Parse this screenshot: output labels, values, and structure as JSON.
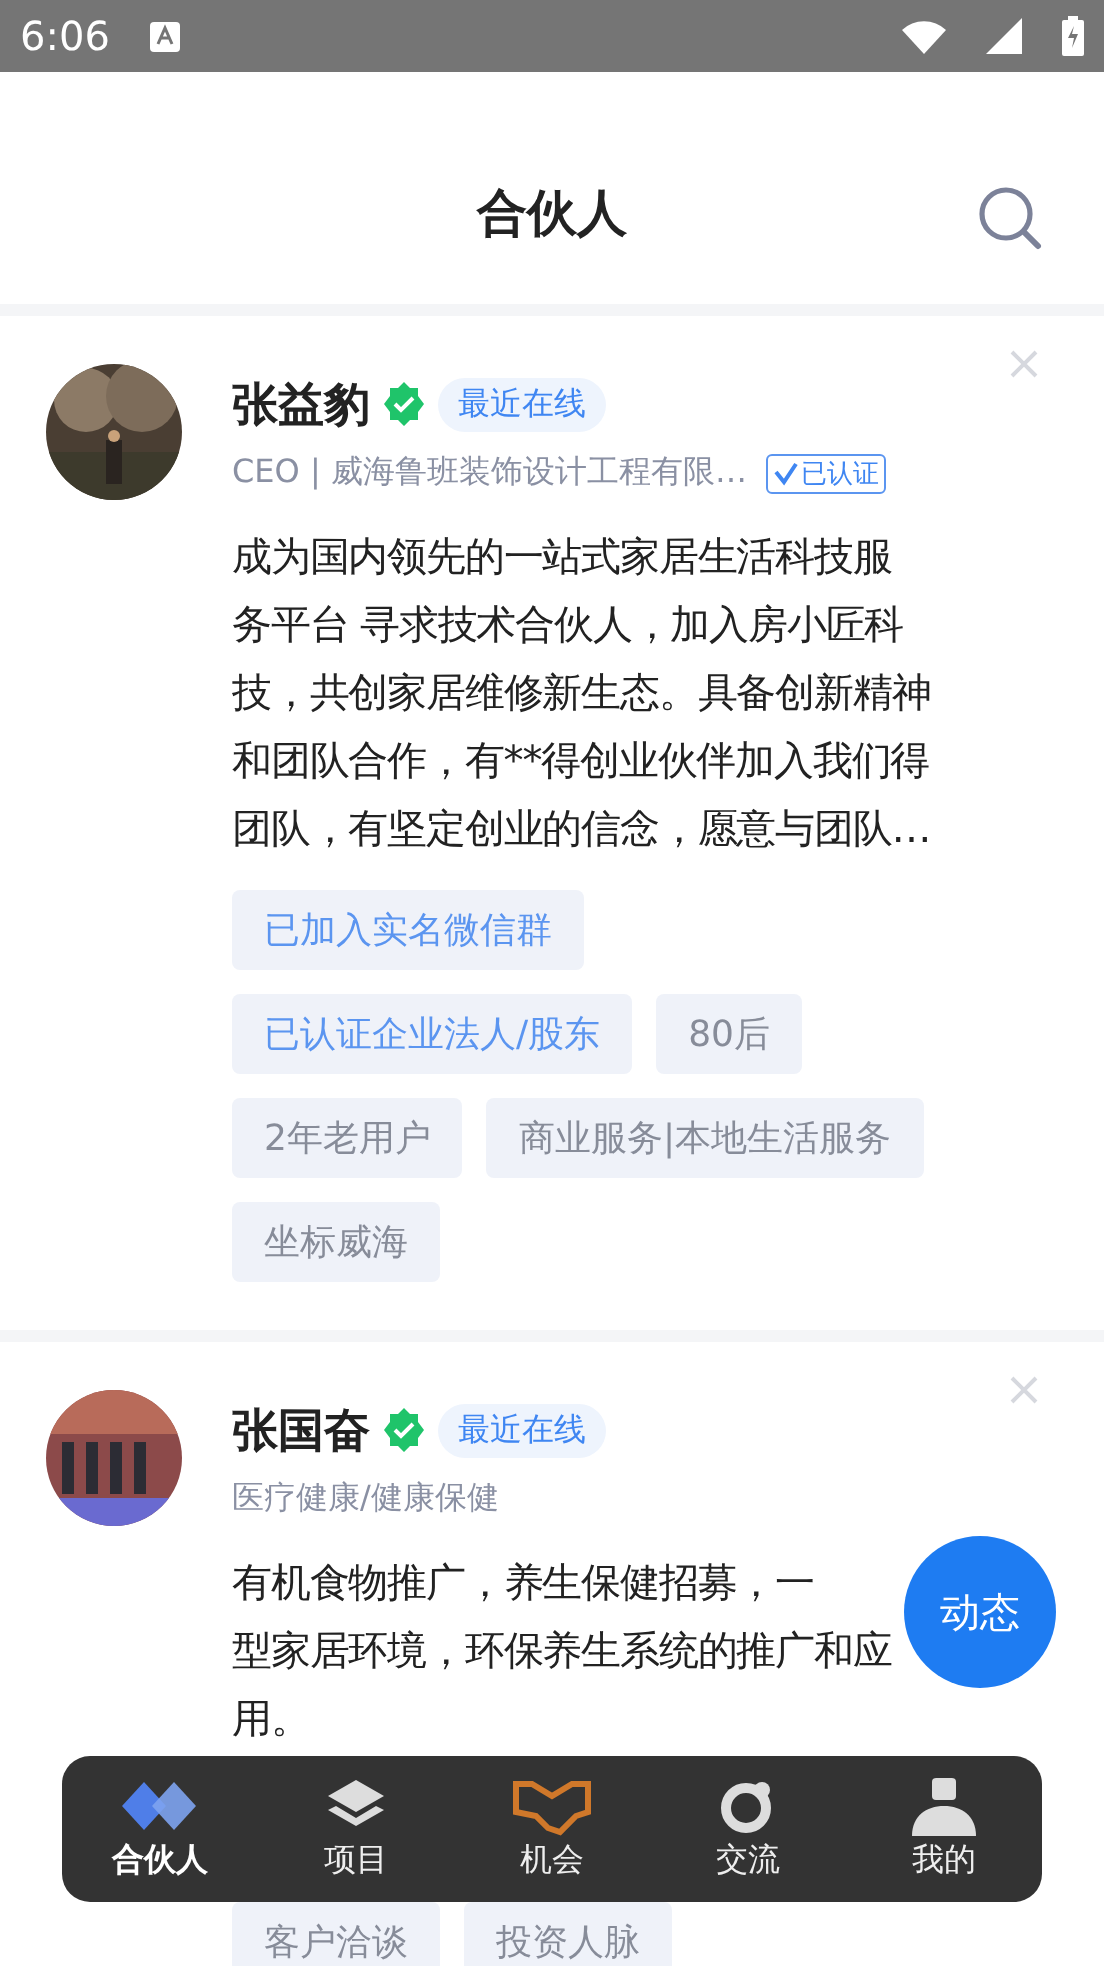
{
  "status_bar": {
    "time": "6:06"
  },
  "header": {
    "title": "合伙人"
  },
  "cards": [
    {
      "name": "张益豹",
      "verified": true,
      "presence": "最近在线",
      "subtitle": "CEO | 威海鲁班装饰设计工程有限…",
      "certified": "已认证",
      "description": [
        "成为国内领先的一站式家居生活科技服",
        "务平台 寻求技术合伙人，加入房小匠科",
        "技，共创家居维修新生态。具备创新精神",
        "和团队合作，有**得创业伙伴加入我们得",
        "团队，有坚定创业的信念，愿意与团队…"
      ],
      "tags": [
        [
          {
            "label": "已加入实名微信群",
            "highlighted": true
          }
        ],
        [
          {
            "label": "已认证企业法人/股东",
            "highlighted": true
          },
          {
            "label": "80后",
            "highlighted": false
          }
        ],
        [
          {
            "label": "2年老用户",
            "highlighted": false
          },
          {
            "label": "商业服务|本地生活服务",
            "highlighted": false
          }
        ],
        [
          {
            "label": "坐标威海",
            "highlighted": false
          }
        ]
      ]
    },
    {
      "name": "张国奋",
      "verified": true,
      "presence": "最近在线",
      "subtitle": "医疗健康/健康保健",
      "description": [
        "有机食物推广，养生保健招募，一",
        "型家居环境，环保养生系统的推广和应",
        "用。"
      ],
      "tags": [
        [
          {
            "label": "客户洽谈",
            "highlighted": false
          },
          {
            "label": "投资人脉",
            "highlighted": false
          }
        ]
      ]
    }
  ],
  "fab": {
    "label": "动态"
  },
  "tab_bar": [
    {
      "label": "合伙人",
      "selected": true
    },
    {
      "label": "项目",
      "selected": false
    },
    {
      "label": "机会",
      "selected": false
    },
    {
      "label": "交流",
      "selected": false
    },
    {
      "label": "我的",
      "selected": false
    }
  ]
}
